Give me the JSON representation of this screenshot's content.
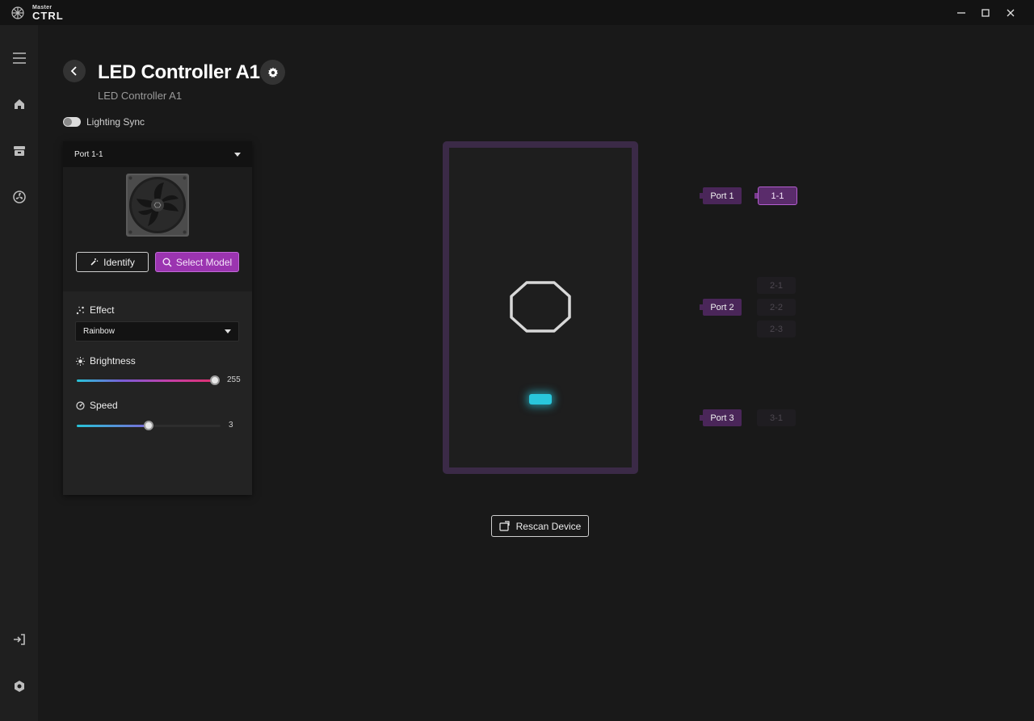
{
  "app": {
    "logo_small": "Master",
    "logo_big": "CTRL"
  },
  "header": {
    "title": "LED Controller A1",
    "subtitle": "LED Controller A1"
  },
  "lighting_sync": {
    "label": "Lighting Sync",
    "enabled": false
  },
  "panel": {
    "port_select": "Port 1-1",
    "identify_label": "Identify",
    "select_model_label": "Select Model",
    "effect_label": "Effect",
    "effect_value": "Rainbow",
    "brightness_label": "Brightness",
    "brightness_value": "255",
    "brightness_fraction": 1.0,
    "speed_label": "Speed",
    "speed_value": "3",
    "speed_fraction": 0.5
  },
  "device": {
    "rescan_label": "Rescan Device"
  },
  "ports": [
    {
      "label": "Port 1",
      "slots": [
        {
          "label": "1-1",
          "active": true
        }
      ]
    },
    {
      "label": "Port 2",
      "slots": [
        {
          "label": "2-1",
          "active": false
        },
        {
          "label": "2-2",
          "active": false
        },
        {
          "label": "2-3",
          "active": false
        }
      ]
    },
    {
      "label": "Port 3",
      "slots": [
        {
          "label": "3-1",
          "active": false
        }
      ]
    }
  ],
  "colors": {
    "accent": "#9b34b0",
    "port_tag": "#4a2659",
    "device_border": "#3b2a47",
    "led": "#29c6dc"
  }
}
